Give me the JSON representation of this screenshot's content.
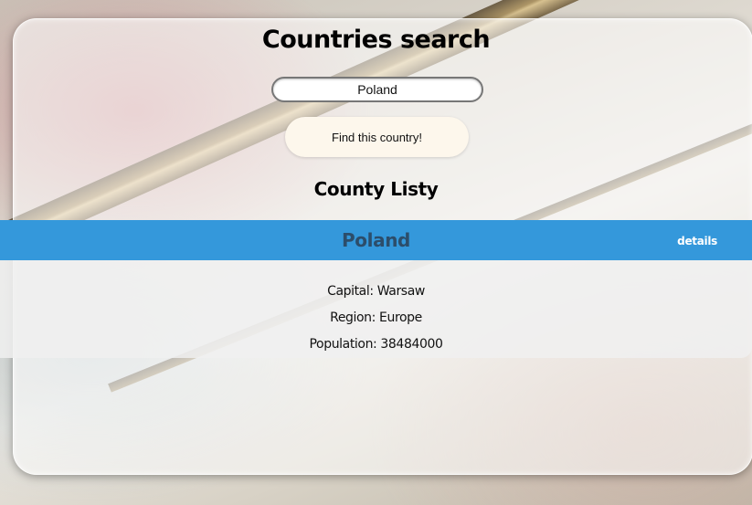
{
  "header": {
    "title": "Countries search"
  },
  "search": {
    "value": "Poland",
    "button_label": "Find this country!"
  },
  "list": {
    "title": "County Listy",
    "country": {
      "name": "Poland",
      "details_label": "details",
      "capital": "Capital: Warsaw",
      "region": "Region: Europe",
      "population": "Population: 38484000"
    }
  },
  "colors": {
    "accent": "#3498db",
    "country_name": "#2c4d6a",
    "button_bg": "#fdf7ec"
  }
}
